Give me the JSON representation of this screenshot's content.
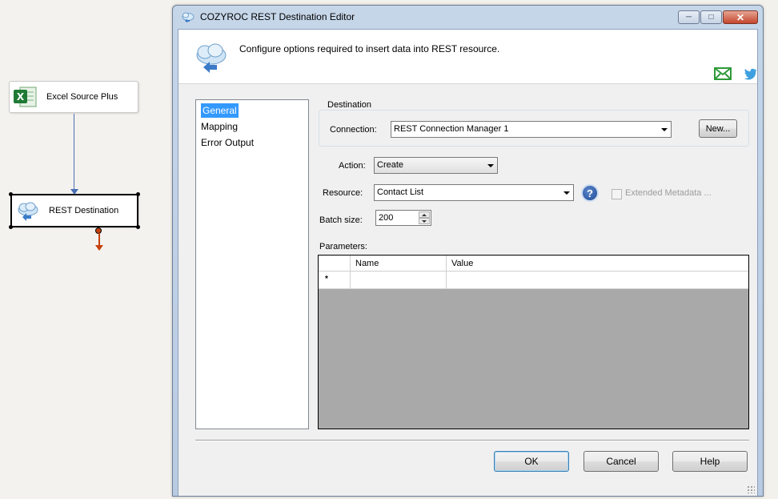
{
  "canvas": {
    "excel_node_label": "Excel Source Plus",
    "rest_node_label": "REST Destination"
  },
  "window": {
    "title": "COZYROC REST Destination Editor",
    "description": "Configure options required to insert data into REST resource."
  },
  "nav": {
    "items": [
      "General",
      "Mapping",
      "Error Output"
    ],
    "selected": "General"
  },
  "destination": {
    "group_title": "Destination",
    "connection_label": "Connection:",
    "connection_value": "REST Connection Manager 1",
    "new_button": "New..."
  },
  "action": {
    "label": "Action:",
    "value": "Create"
  },
  "resource": {
    "label": "Resource:",
    "value": "Contact List",
    "help": "?",
    "extended_metadata_label": "Extended Metadata ..."
  },
  "batch": {
    "label": "Batch size:",
    "value": "200"
  },
  "parameters": {
    "label": "Parameters:",
    "columns": [
      "Name",
      "Value"
    ],
    "new_row_marker": "*"
  },
  "buttons": {
    "ok": "OK",
    "cancel": "Cancel",
    "help": "Help"
  },
  "colors": {
    "accent_selected": "#3399ff",
    "connector": "#4a6fb6",
    "error_output": "#c4420a",
    "mail_icon": "#2f9a3a",
    "twitter_icon": "#3fa0e0"
  }
}
